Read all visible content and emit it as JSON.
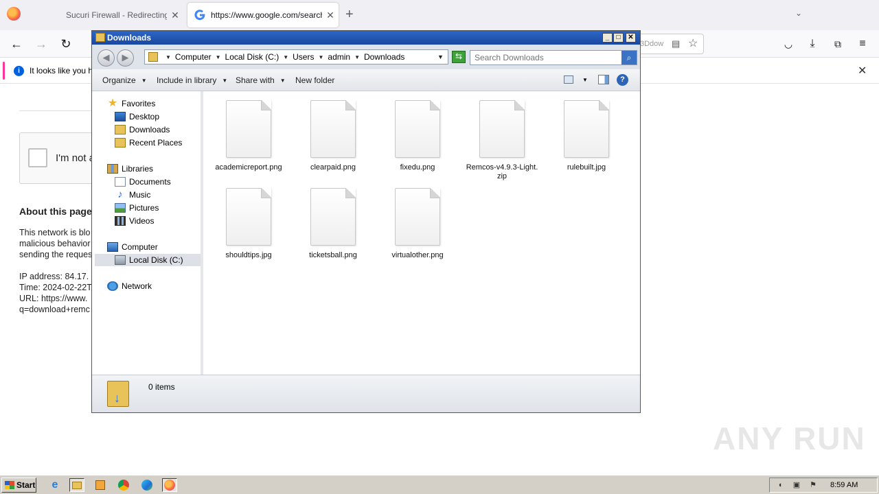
{
  "browser": {
    "tabs": [
      {
        "title": "Sucuri Firewall - Redirecting…",
        "active": false
      },
      {
        "title": "https://www.google.com/search?c",
        "active": true
      }
    ],
    "url_tail": "3Ddow",
    "notification": "It looks like you ha"
  },
  "page": {
    "captcha_label": "I'm not a",
    "about_heading": "About this page",
    "para_lines": [
      "This network is blo",
      "malicious behavior",
      "sending the reques"
    ],
    "info_lines": [
      "IP address: 84.17.",
      "Time: 2024-02-22T",
      "URL: https://www.",
      "q=download+remc"
    ]
  },
  "explorer": {
    "title": "Downloads",
    "breadcrumbs": [
      "Computer",
      "Local Disk (C:)",
      "Users",
      "admin",
      "Downloads"
    ],
    "search_placeholder": "Search Downloads",
    "commands": [
      "Organize",
      "Include in library",
      "Share with",
      "New folder"
    ],
    "nav": {
      "favorites": "Favorites",
      "desktop": "Desktop",
      "downloads": "Downloads",
      "recent": "Recent Places",
      "libraries": "Libraries",
      "documents": "Documents",
      "music": "Music",
      "pictures": "Pictures",
      "videos": "Videos",
      "computer": "Computer",
      "localdisk": "Local Disk (C:)",
      "network": "Network"
    },
    "files": [
      "academicreport.png",
      "clearpaid.png",
      "fixedu.png",
      "Remcos-v4.9.3-Light.zip",
      "rulebuilt.jpg",
      "shouldtips.jpg",
      "ticketsball.png",
      "virtualother.png"
    ],
    "status": "0 items"
  },
  "taskbar": {
    "start": "Start",
    "clock": "8:59 AM"
  },
  "watermark": "ANY RUN"
}
